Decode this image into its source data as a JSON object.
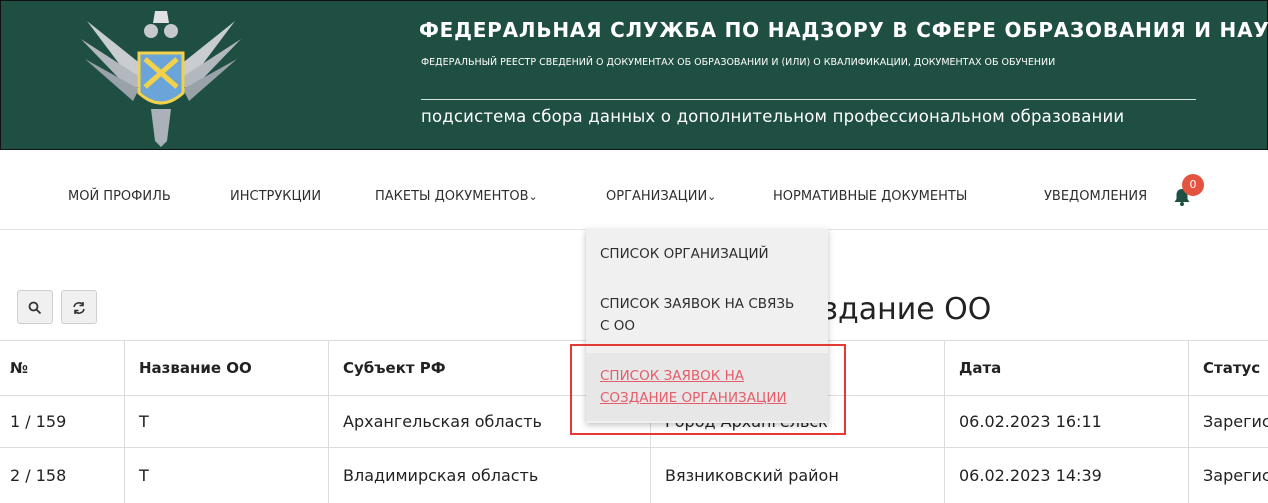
{
  "header": {
    "title": "ФЕДЕРАЛЬНАЯ СЛУЖБА ПО НАДЗОРУ В СФЕРЕ ОБРАЗОВАНИЯ И НАУКИ",
    "subtitle": "ФЕДЕРАЛЬНЫЙ РЕЕСТР СВЕДЕНИЙ О ДОКУМЕНТАХ ОБ ОБРАЗОВАНИИ И (ИЛИ) О КВАЛИФИКАЦИИ, ДОКУМЕНТАХ ОБ ОБУЧЕНИИ",
    "subsystem": "подсистема сбора данных о дополнительном профессиональном образовании",
    "emblem_icon": "eagle-emblem-icon",
    "background_color": "#1f4f42"
  },
  "nav": {
    "items": [
      {
        "label": "МОЙ ПРОФИЛЬ",
        "caret": ""
      },
      {
        "label": "ИНСТРУКЦИИ",
        "caret": ""
      },
      {
        "label": "ПАКЕТЫ ДОКУМЕНТОВ",
        "caret": "⌄"
      },
      {
        "label": "ОРГАНИЗАЦИИ",
        "caret": "⌄"
      },
      {
        "label": "НОРМАТИВНЫЕ ДОКУМЕНТЫ",
        "caret": ""
      },
      {
        "label": "УВЕДОМЛЕНИЯ",
        "caret": ""
      }
    ],
    "notifications_count": "0",
    "bell_icon": "bell-icon"
  },
  "dropdown": {
    "items": [
      {
        "label_lines": [
          "СПИСОК ОРГАНИЗАЦИЙ"
        ]
      },
      {
        "label_lines": [
          "СПИСОК ЗАЯВОК НА СВЯЗЬ",
          "С ОО"
        ]
      },
      {
        "label_lines": [
          "СПИСОК ЗАЯВОК НА",
          "СОЗДАНИЕ ОРГАНИЗАЦИИ"
        ],
        "active": true
      }
    ],
    "active_color": "#e35d6a",
    "highlight_color": "#e53935"
  },
  "toolbar": {
    "search_icon": "search-icon",
    "refresh_icon": "refresh-icon"
  },
  "page": {
    "title_visible": "здание ОО"
  },
  "table": {
    "headers": [
      "№",
      "Название ОО",
      "Субъект РФ",
      "",
      "Дата",
      "Статус"
    ],
    "rows": [
      [
        "1 / 159",
        "Т",
        "Архангельская область",
        "Город Архангельск",
        "06.02.2023 16:11",
        "Зарегистрирована"
      ],
      [
        "2 / 158",
        "Т",
        "Владимирская область",
        "Вязниковский район",
        "06.02.2023 14:39",
        "Зарегистрирована"
      ]
    ]
  }
}
